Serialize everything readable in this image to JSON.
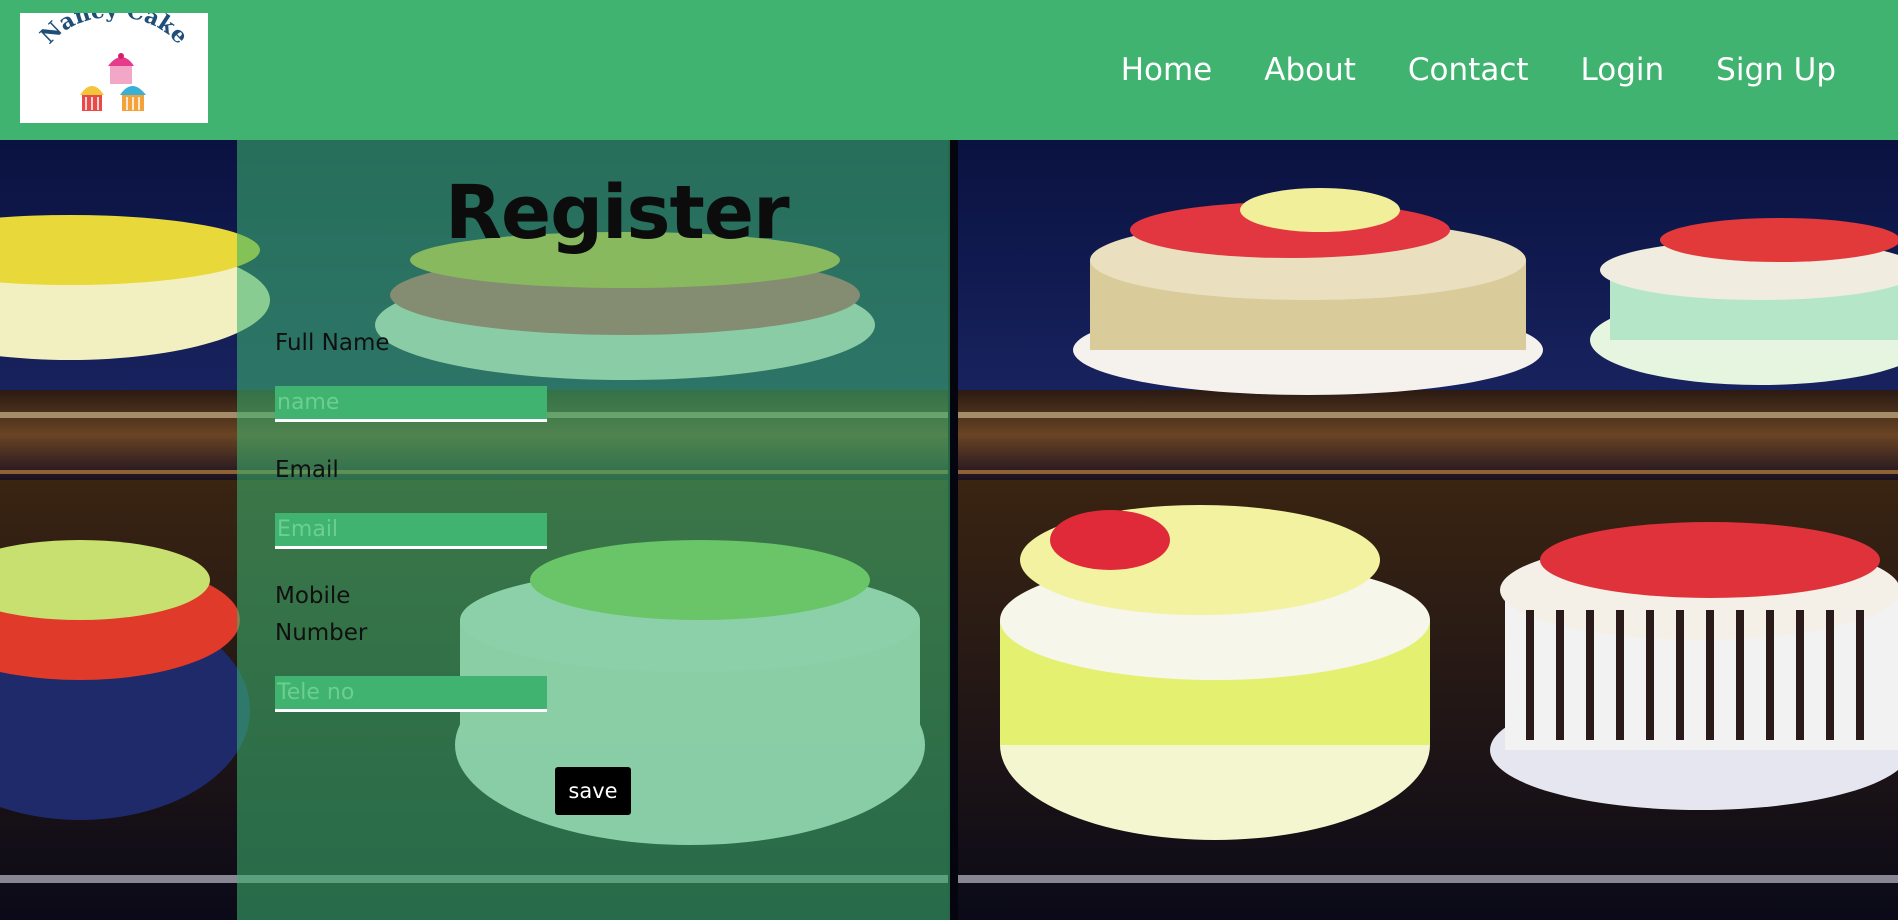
{
  "logo": {
    "text": "Nancy Cake",
    "icon": "cupcakes-logo"
  },
  "nav": {
    "items": [
      {
        "label": "Home"
      },
      {
        "label": "About"
      },
      {
        "label": "Contact"
      },
      {
        "label": "Login"
      },
      {
        "label": "Sign Up"
      }
    ]
  },
  "colors": {
    "header": "#3fb36f",
    "field": "#3fb36f",
    "button": "#000000"
  },
  "form": {
    "title": "Register",
    "full_name": {
      "label": "Full Name",
      "placeholder": "name",
      "value": ""
    },
    "email": {
      "label": "Email",
      "placeholder": "Email",
      "value": ""
    },
    "mobile": {
      "label_line1": "Mobile",
      "label_line2": "Number",
      "placeholder": "Tele no",
      "value": ""
    },
    "save_label": "save"
  },
  "background": {
    "image": "cakes-display-case-photo"
  }
}
